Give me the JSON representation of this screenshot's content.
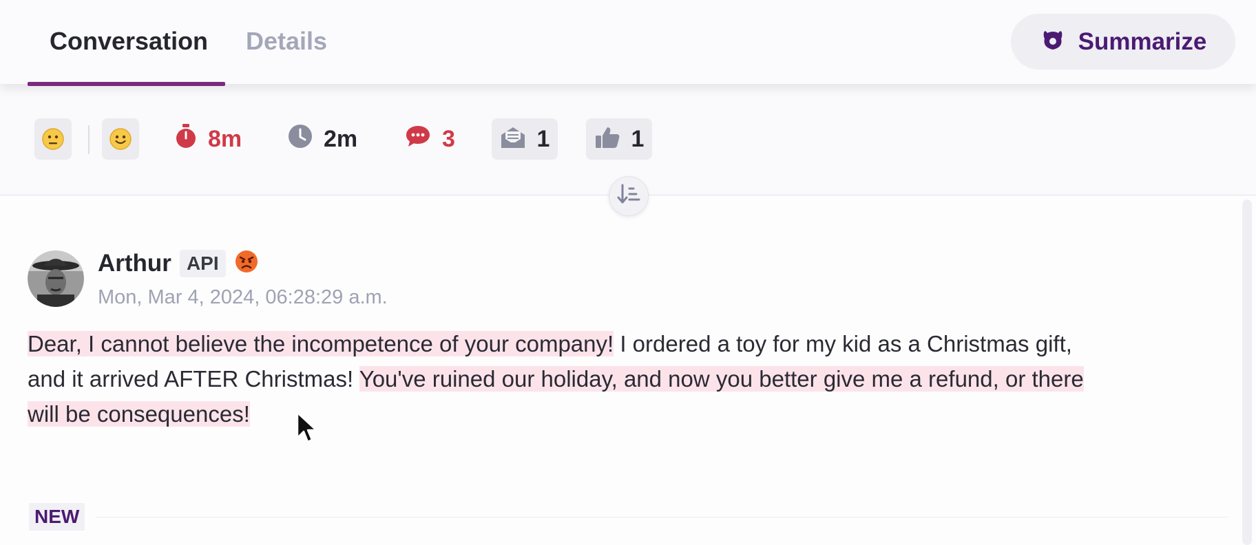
{
  "header": {
    "tabs": [
      {
        "label": "Conversation",
        "active": true
      },
      {
        "label": "Details",
        "active": false
      }
    ],
    "summarize_label": "Summarize",
    "summarize_icon": "ai-sparkle-icon",
    "accent_color": "#7b2a7e"
  },
  "stats": {
    "sentiment_1_icon": "neutral-face-icon",
    "sentiment_2_icon": "smiling-face-icon",
    "first_response": {
      "icon": "stopwatch-icon",
      "value": "8m",
      "color": "#d03a48"
    },
    "avg_response": {
      "icon": "clock-icon",
      "value": "2m"
    },
    "messages": {
      "icon": "chat-bubble-icon",
      "value": "3",
      "color": "#d03a48"
    },
    "emails": {
      "icon": "envelope-icon",
      "value": "1"
    },
    "likes": {
      "icon": "thumbs-up-icon",
      "value": "1"
    }
  },
  "message": {
    "author": "Arthur",
    "badge": "API",
    "mood_icon": "angry-face-icon",
    "timestamp": "Mon, Mar 4, 2024, 06:28:29 a.m.",
    "segments": [
      {
        "text": "Dear, I cannot believe the incompetence of your company!",
        "highlight": true
      },
      {
        "text": " I ordered a toy for my kid as a Christmas gift, and it arrived AFTER Christmas! ",
        "highlight": false
      },
      {
        "text": "You've ruined our holiday, and now you better give me a refund, or there will be consequences!",
        "highlight": true
      }
    ]
  },
  "divider": {
    "label": "NEW"
  }
}
